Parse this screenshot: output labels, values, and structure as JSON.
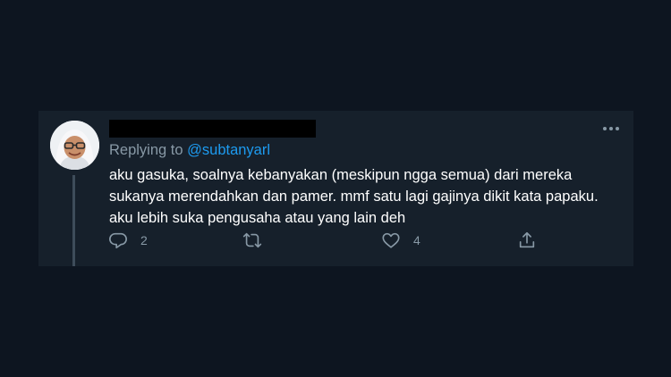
{
  "tweet": {
    "replying_prefix": "Replying to ",
    "replying_handle": "@subtanyarl",
    "lines": [
      "aku gasuka, soalnya kebanyakan (meskipun ngga semua) dari mereka",
      "sukanya merendahkan dan pamer. mmf satu lagi gajinya dikit kata papaku.",
      "aku lebih suka pengusaha atau yang lain deh"
    ]
  },
  "actions": {
    "reply_icon": "reply-icon",
    "reply_count": "2",
    "retweet_icon": "retweet-icon",
    "retweet_count": "",
    "like_icon": "heart-icon",
    "like_count": "4",
    "share_icon": "share-icon"
  },
  "menu_icon": "more-icon",
  "colors": {
    "background": "#0d1520",
    "card": "#16202b",
    "link": "#1d9bf0",
    "muted": "#8899a6",
    "text": "#ffffff"
  }
}
